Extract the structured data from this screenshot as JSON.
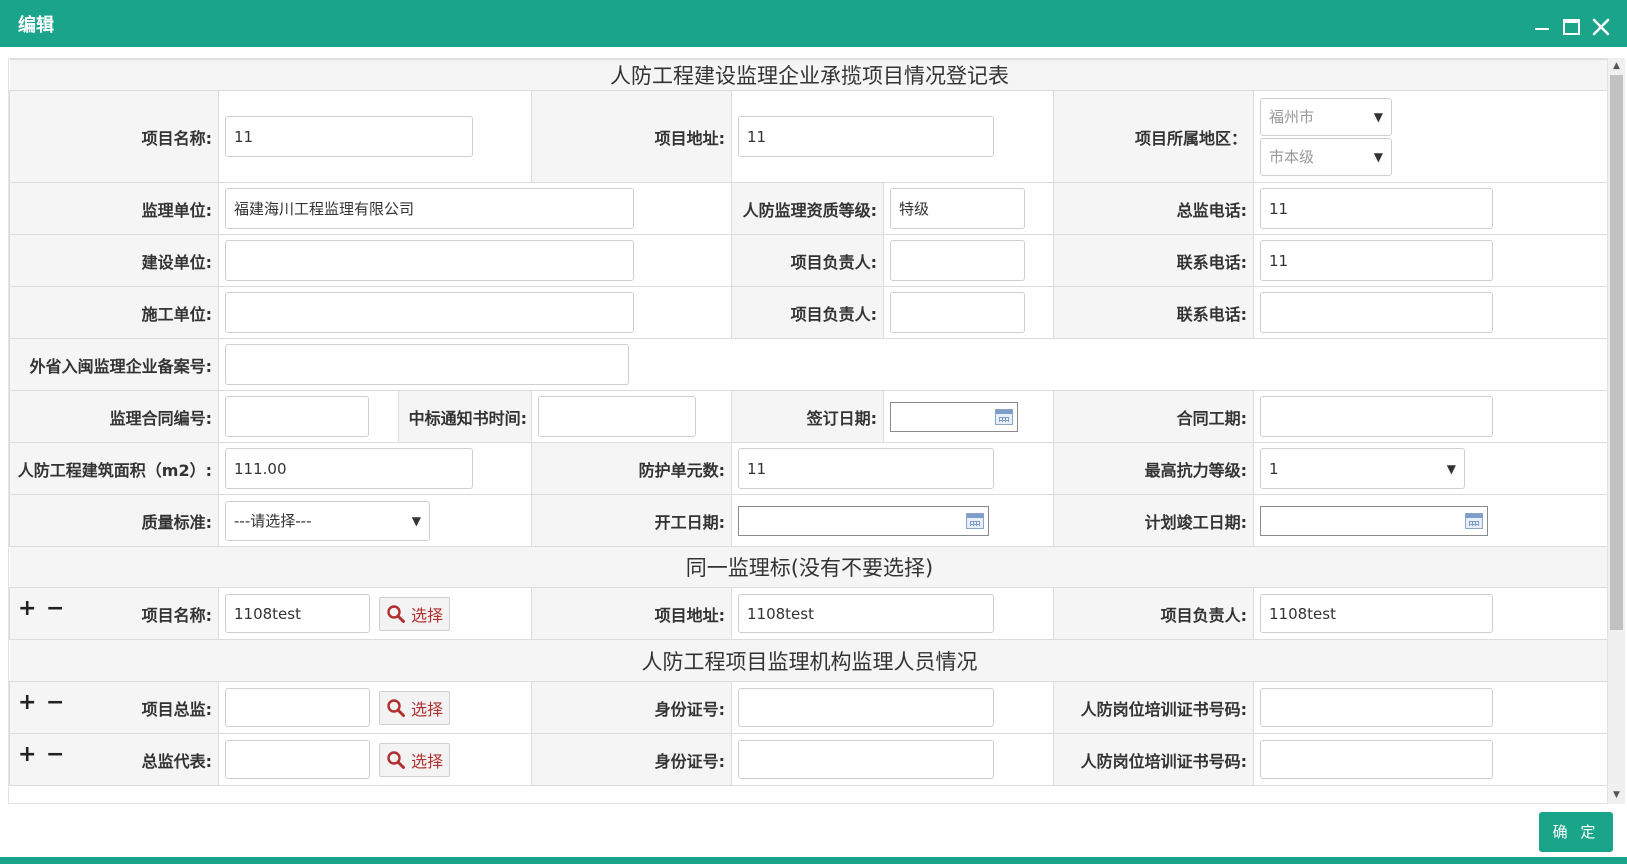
{
  "window": {
    "title": "编辑",
    "confirm_label": "确 定"
  },
  "sections": {
    "main_title": "人防工程建设监理企业承揽项目情况登记表",
    "same_bid_title": "同一监理标(没有不要选择)",
    "staff_title": "人防工程项目监理机构监理人员情况"
  },
  "labels": {
    "project_name": "项目名称:",
    "project_address": "项目地址:",
    "project_region": "项目所属地区：",
    "supervision_unit": "监理单位:",
    "qualification": "人防监理资质等级:",
    "chief_phone": "总监电话:",
    "construction_owner": "建设单位:",
    "project_leader": "项目负责人:",
    "contact_phone": "联系电话:",
    "builder_unit": "施工单位:",
    "out_of_province_no": "外省入闽监理企业备案号:",
    "contract_no": "监理合同编号:",
    "award_notice_time": "中标通知书时间:",
    "sign_date": "签订日期:",
    "contract_period": "合同工期:",
    "building_area": "人防工程建筑面积（m2）:",
    "protection_units": "防护单元数:",
    "max_resistance": "最高抗力等级:",
    "quality_standard": "质量标准:",
    "start_date": "开工日期:",
    "planned_completion": "计划竣工日期:",
    "project_chief": "项目总监:",
    "id_number": "身份证号:",
    "training_cert": "人防岗位培训证书号码:",
    "chief_deputy": "总监代表:"
  },
  "values": {
    "project_name": "11",
    "project_address": "11",
    "region_city": "福州市",
    "region_level": "市本级",
    "supervision_unit": "福建海川工程监理有限公司",
    "qualification": "特级",
    "chief_phone": "11",
    "construction_owner": "",
    "owner_leader": "",
    "owner_phone": "11",
    "builder_unit": "",
    "builder_leader": "",
    "builder_phone": "",
    "out_of_province_no": "",
    "contract_no": "",
    "award_notice_time": "",
    "sign_date": "",
    "contract_period": "",
    "building_area": "111.00",
    "protection_units": "11",
    "max_resistance": "1",
    "quality_standard": "---请选择---",
    "start_date": "",
    "planned_completion": "",
    "same_bid_name": "1108test",
    "same_bid_address": "1108test",
    "same_bid_leader": "1108test",
    "project_chief": "",
    "chief_id": "",
    "chief_cert": "",
    "chief_deputy": "",
    "deputy_id": "",
    "deputy_cert": ""
  },
  "buttons": {
    "select_label": "选择",
    "plus": "+",
    "minus": "−"
  },
  "colors": {
    "accent": "#1aa58b",
    "select_text": "#b03030"
  }
}
